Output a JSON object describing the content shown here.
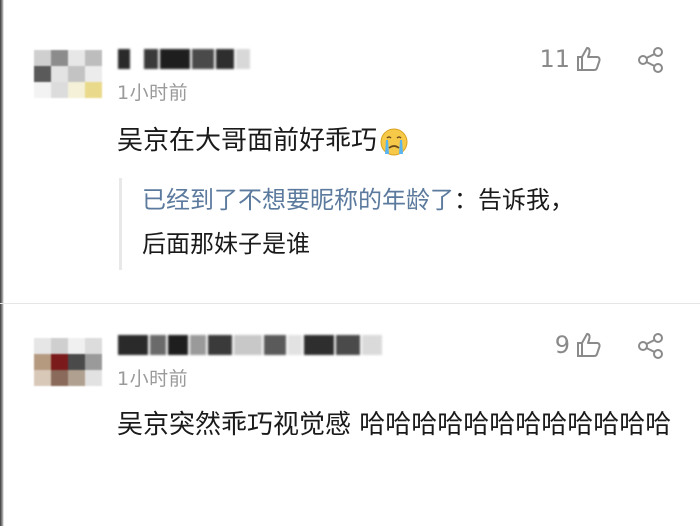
{
  "comments": [
    {
      "time": "1小时前",
      "likes": "11",
      "text": "吴京在大哥面前好乖巧",
      "emoji": "crying-face-emoji",
      "reply": {
        "author": "已经到了不想要昵称的年龄了",
        "separator": "：",
        "text_line1": "告诉我，",
        "text_line2": "后面那妹子是谁"
      }
    },
    {
      "time": "1小时前",
      "likes": "9",
      "text": "吴京突然乖巧视觉感 哈哈哈哈哈哈哈哈哈哈哈哈"
    }
  ],
  "colors": {
    "link": "#5b7a9d",
    "meta": "#9a9a9a",
    "text": "#1a1a1a"
  },
  "icons": [
    "thumbs-up-icon",
    "share-icon",
    "crying-face-emoji"
  ]
}
